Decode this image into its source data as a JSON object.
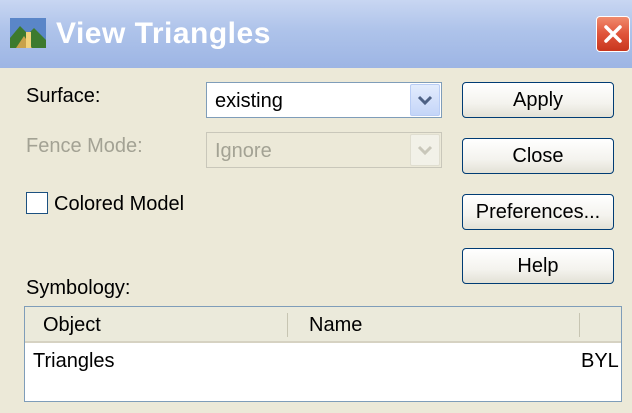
{
  "window": {
    "title": "View Triangles"
  },
  "form": {
    "surface_label": "Surface:",
    "surface_value": "existing",
    "fence_mode_label": "Fence Mode:",
    "fence_mode_value": "Ignore",
    "colored_model_label": "Colored Model",
    "colored_model_checked": false,
    "symbology_label": "Symbology:"
  },
  "buttons": {
    "apply": "Apply",
    "close": "Close",
    "preferences": "Preferences...",
    "help": "Help"
  },
  "symbology_table": {
    "columns": [
      "Object",
      "Name"
    ],
    "rows": [
      {
        "object": "Triangles",
        "name": "BYL"
      }
    ]
  },
  "icons": {
    "title": "landscape-icon",
    "close": "close-x-icon",
    "dropdown": "chevron-down-icon"
  }
}
